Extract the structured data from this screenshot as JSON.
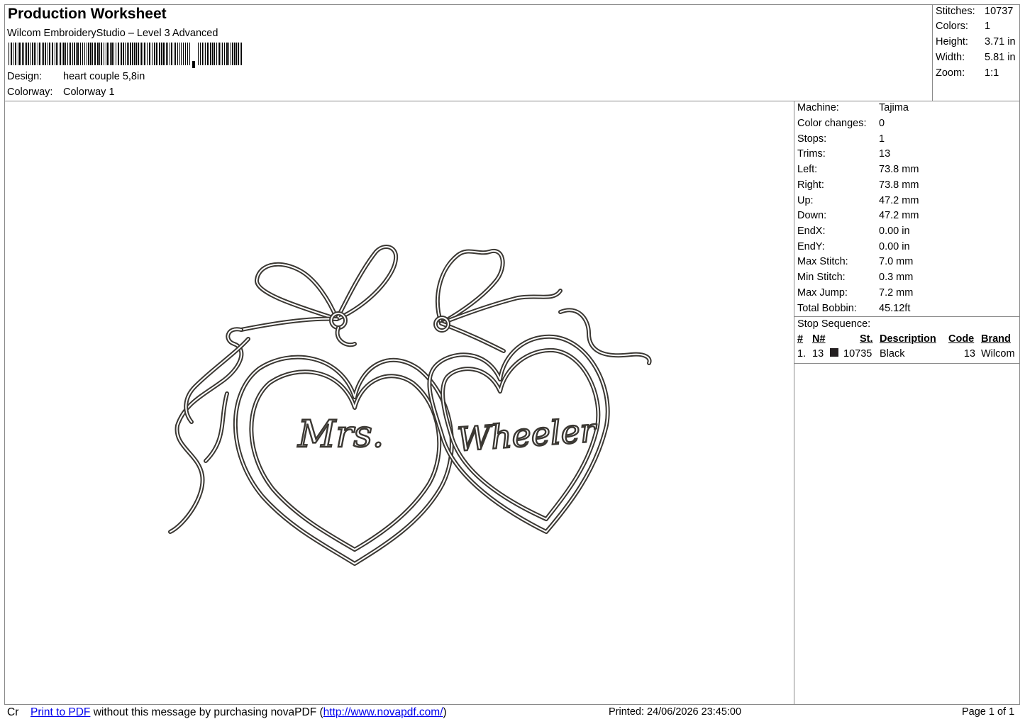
{
  "header": {
    "title": "Production Worksheet",
    "software": "Wilcom EmbroideryStudio – Level 3 Advanced",
    "design_label": "Design:",
    "design_value": "heart couple 5,8in",
    "colorway_label": "Colorway:",
    "colorway_value": "Colorway 1"
  },
  "summary": [
    {
      "label": "Stitches:",
      "value": "10737"
    },
    {
      "label": "Colors:",
      "value": "1"
    },
    {
      "label": "Height:",
      "value": "3.71 in"
    },
    {
      "label": "Width:",
      "value": "5.81 in"
    },
    {
      "label": "Zoom:",
      "value": "1:1"
    }
  ],
  "machine_info": [
    {
      "label": "Machine:",
      "value": "Tajima"
    },
    {
      "label": "Color changes:",
      "value": "0"
    },
    {
      "label": "Stops:",
      "value": "1"
    },
    {
      "label": "Trims:",
      "value": "13"
    },
    {
      "label": "Left:",
      "value": "73.8 mm"
    },
    {
      "label": "Right:",
      "value": "73.8 mm"
    },
    {
      "label": "Up:",
      "value": "47.2 mm"
    },
    {
      "label": "Down:",
      "value": "47.2 mm"
    },
    {
      "label": "EndX:",
      "value": "0.00 in"
    },
    {
      "label": "EndY:",
      "value": "0.00 in"
    },
    {
      "label": "Max Stitch:",
      "value": "7.0 mm"
    },
    {
      "label": "Min Stitch:",
      "value": "0.3 mm"
    },
    {
      "label": "Max Jump:",
      "value": "7.2 mm"
    },
    {
      "label": "Total Bobbin:",
      "value": "45.12ft"
    }
  ],
  "stop_sequence": {
    "title": "Stop Sequence:",
    "columns": [
      "#",
      "N#",
      "St.",
      "Description",
      "Code",
      "Brand"
    ],
    "rows": [
      {
        "index": "1.",
        "needle": "13",
        "color": "#231f20",
        "stitches": "10735",
        "description": "Black",
        "code": "13",
        "brand": "Wilcom"
      }
    ]
  },
  "design": {
    "text_left": "Mrs.",
    "text_right": "Wheeler",
    "thread_color": "#3b3833"
  },
  "footer": {
    "prefix": "Cr",
    "link_text": "Print to PDF",
    "message": " without this message by purchasing novaPDF (",
    "url_text": "http://www.novapdf.com/",
    "suffix": ")",
    "printed": "Printed: 24/06/2026 23:45:00",
    "page": "Page 1 of 1"
  }
}
